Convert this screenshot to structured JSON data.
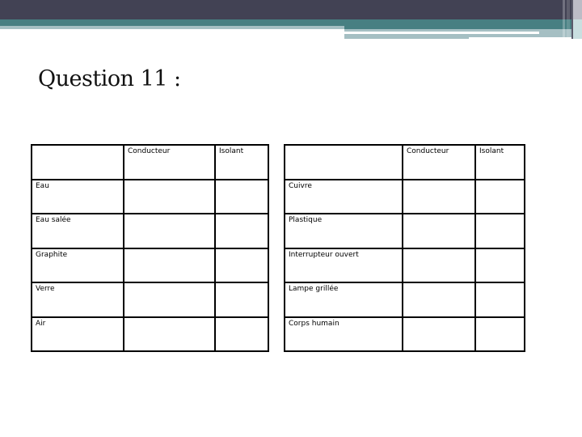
{
  "slide": {
    "title": "Question 11 :",
    "theme_colors": {
      "header_dark": "#424254",
      "header_teal": "#477f82",
      "header_light": "#a5bfc3"
    }
  },
  "tables": [
    {
      "headers": [
        "",
        "Conducteur",
        "Isolant"
      ],
      "rows": [
        {
          "item": "Eau",
          "conducteur": "",
          "isolant": ""
        },
        {
          "item": "Eau salée",
          "conducteur": "",
          "isolant": ""
        },
        {
          "item": "Graphite",
          "conducteur": "",
          "isolant": ""
        },
        {
          "item": "Verre",
          "conducteur": "",
          "isolant": ""
        },
        {
          "item": "Air",
          "conducteur": "",
          "isolant": ""
        }
      ]
    },
    {
      "headers": [
        "",
        "Conducteur",
        "Isolant"
      ],
      "rows": [
        {
          "item": "Cuivre",
          "conducteur": "",
          "isolant": ""
        },
        {
          "item": "Plastique",
          "conducteur": "",
          "isolant": ""
        },
        {
          "item": "Interrupteur ouvert",
          "conducteur": "",
          "isolant": ""
        },
        {
          "item": "Lampe grillée",
          "conducteur": "",
          "isolant": ""
        },
        {
          "item": "Corps humain",
          "conducteur": "",
          "isolant": ""
        }
      ]
    }
  ]
}
